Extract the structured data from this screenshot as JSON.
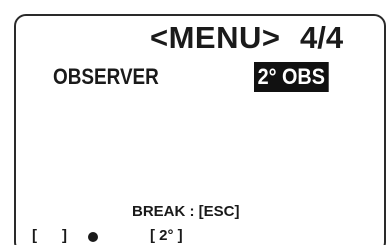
{
  "menu": {
    "title": "<MENU>",
    "page": "4/4"
  },
  "setting": {
    "label": "OBSERVER",
    "value": "2° OBS"
  },
  "footer": {
    "break_hint": "BREAK : [ESC]",
    "left_bracket": "[      ]",
    "indicator_icon": "filled-circle",
    "right_value": "[ 2° ]"
  },
  "colors": {
    "background": "#ffffff",
    "text": "#1a1a1a",
    "highlight_bg": "#111111",
    "highlight_text": "#ffffff"
  }
}
